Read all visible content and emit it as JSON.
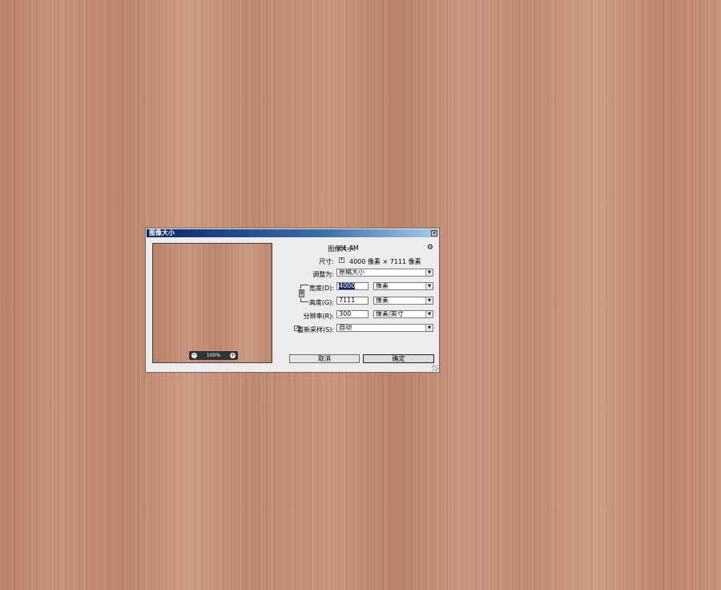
{
  "dialog": {
    "title": "图像大小",
    "close_glyph": "✕",
    "image_size_label": "图像大小:",
    "image_size_value": "81.4M",
    "dimensions_label": "尺寸:",
    "dimensions_value": "4000 像素  ×  7111 像素",
    "fit_label": "调整为:",
    "fit_value": "原稿大小",
    "width_label": "宽度(D):",
    "width_value": "4000",
    "width_unit": "像素",
    "height_label": "高度(G):",
    "height_value": "7111",
    "height_unit": "像素",
    "resolution_label": "分辨率(R):",
    "resolution_value": "300",
    "resolution_unit": "像素/英寸",
    "resample_label": "重新采样(S):",
    "resample_checked": "✓",
    "resample_value": "自动",
    "cancel_label": "取消",
    "ok_label": "确定",
    "zoom_level": "100%",
    "gear_glyph": "⚙",
    "dropdown_glyph": "▼",
    "link_glyph": "8",
    "minus_glyph": "−",
    "plus_glyph": "+",
    "dim_icon_glyph": "▾"
  },
  "icons": {
    "close": "close-icon",
    "gear": "gear-icon",
    "link": "chain-link-icon",
    "zoom_out": "zoom-out-icon",
    "zoom_in": "zoom-in-icon"
  },
  "colors": {
    "titlebar_start": "#0a246a",
    "titlebar_end": "#a6caf0",
    "background_wood": "#c48a70",
    "dialog_bg": "#ececec"
  }
}
